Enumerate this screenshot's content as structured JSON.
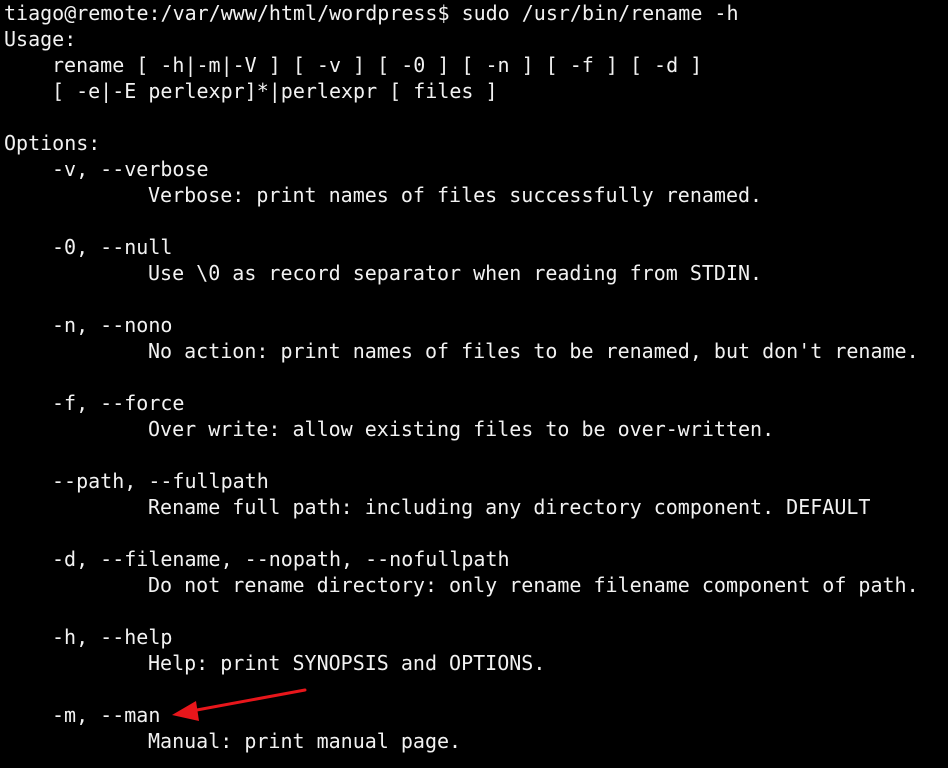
{
  "terminal": {
    "prompt": "tiago@remote:/var/www/html/wordpress$ ",
    "command": "sudo /usr/bin/rename -h",
    "usage_heading": "Usage:",
    "usage_line1": "rename [ -h|-m|-V ] [ -v ] [ -0 ] [ -n ] [ -f ] [ -d ]",
    "usage_line2": "[ -e|-E perlexpr]*|perlexpr [ files ]",
    "options_heading": "Options:",
    "options": [
      {
        "flag": "-v, --verbose",
        "desc": "Verbose: print names of files successfully renamed."
      },
      {
        "flag": "-0, --null",
        "desc": "Use \\0 as record separator when reading from STDIN."
      },
      {
        "flag": "-n, --nono",
        "desc": "No action: print names of files to be renamed, but don't rename."
      },
      {
        "flag": "-f, --force",
        "desc": "Over write: allow existing files to be over-written."
      },
      {
        "flag": "--path, --fullpath",
        "desc": "Rename full path: including any directory component. DEFAULT"
      },
      {
        "flag": "-d, --filename, --nopath, --nofullpath",
        "desc": "Do not rename directory: only rename filename component of path."
      },
      {
        "flag": "-h, --help",
        "desc": "Help: print SYNOPSIS and OPTIONS."
      },
      {
        "flag": "-m, --man",
        "desc": "Manual: print manual page."
      }
    ],
    "colors": {
      "background": "#000000",
      "text": "#f2f2f2",
      "annotation_arrow": "#e8161b"
    }
  },
  "annotation": {
    "icon": "arrow-icon",
    "points_to": "-m, --man"
  }
}
